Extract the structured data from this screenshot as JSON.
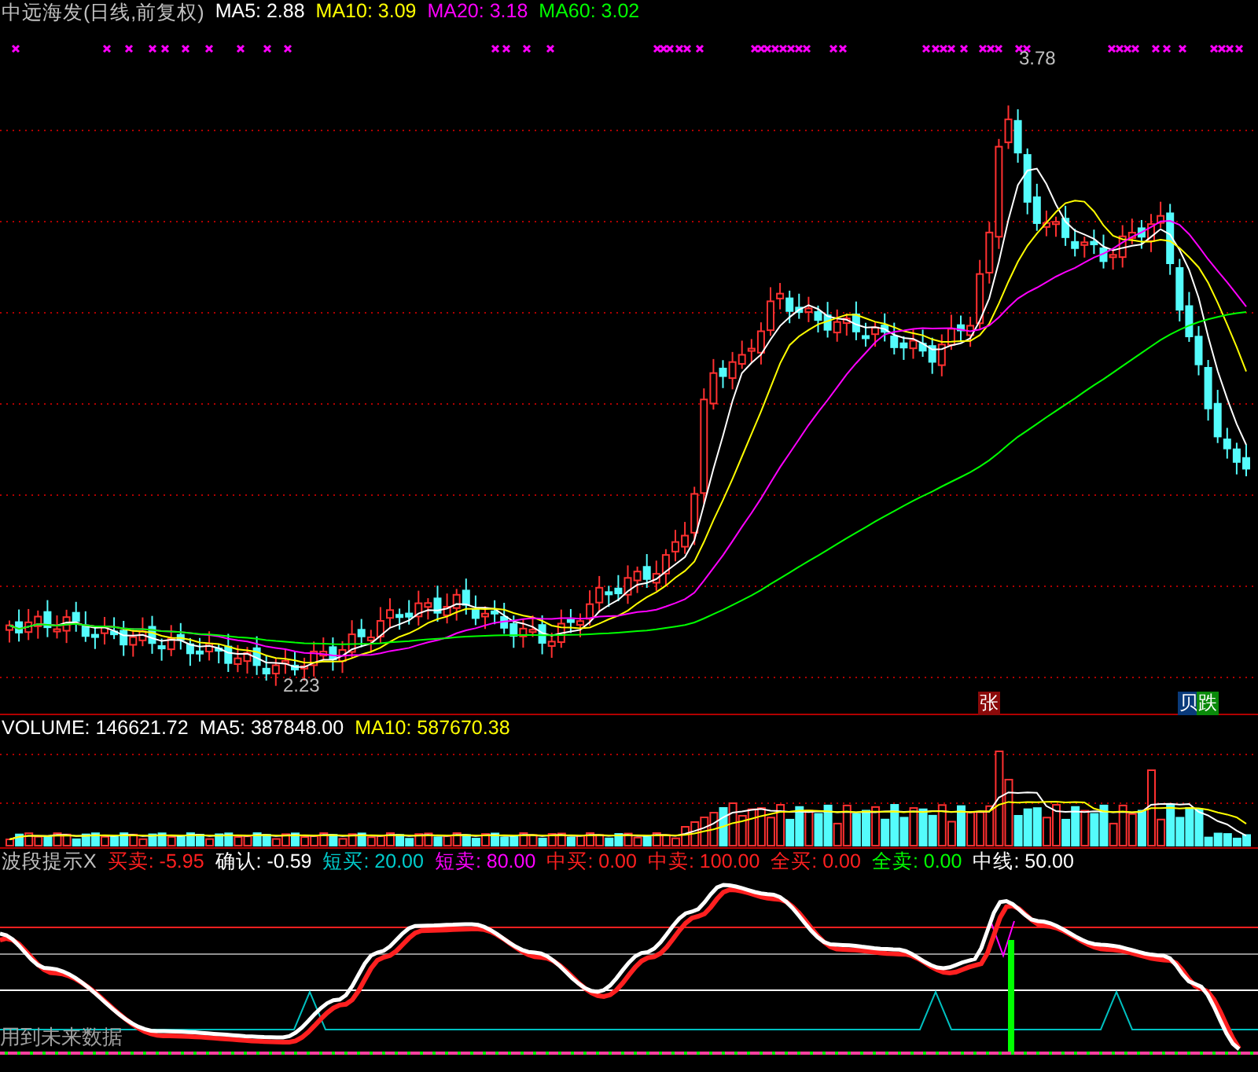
{
  "quote_header": {
    "title": "中远海发(日线,前复权)",
    "items": [
      {
        "text": "MA5: 2.88",
        "color": "#ffffff"
      },
      {
        "text": "MA10: 3.09",
        "color": "#ffff00"
      },
      {
        "text": "MA20: 3.18",
        "color": "#ff00ff"
      },
      {
        "text": "MA60: 3.02",
        "color": "#00ff00"
      }
    ]
  },
  "price_chart": {
    "high_label": "3.78",
    "low_label": "2.23",
    "signals": [
      {
        "text": "张",
        "color": "#8b0a0a"
      },
      {
        "text": "贝",
        "color": "#0a3a7a"
      },
      {
        "text": "跌",
        "color": "#0a8a0a"
      }
    ]
  },
  "volume_header": {
    "items": [
      {
        "text": "VOLUME: 146621.72",
        "color": "#ffffff"
      },
      {
        "text": "MA5: 387848.00",
        "color": "#ffffff"
      },
      {
        "text": "MA10: 587670.38",
        "color": "#ffff00"
      }
    ]
  },
  "indicator_header": {
    "title": "波段提示X",
    "items": [
      {
        "text": "买卖: -5.95",
        "color": "#ff2020"
      },
      {
        "text": "确认: -0.59",
        "color": "#ffffff"
      },
      {
        "text": "短买: 20.00",
        "color": "#00cccc"
      },
      {
        "text": "短卖: 80.00",
        "color": "#ff00ff"
      },
      {
        "text": "中买: 0.00",
        "color": "#ff2020"
      },
      {
        "text": "中卖: 100.00",
        "color": "#ff2020"
      },
      {
        "text": "全买: 0.00",
        "color": "#ff2020"
      },
      {
        "text": "全卖: 0.00",
        "color": "#00ff00"
      },
      {
        "text": "中线: 50.00",
        "color": "#ffffff"
      }
    ]
  },
  "indicator_chart": {
    "note": "用到未来数据"
  }
}
